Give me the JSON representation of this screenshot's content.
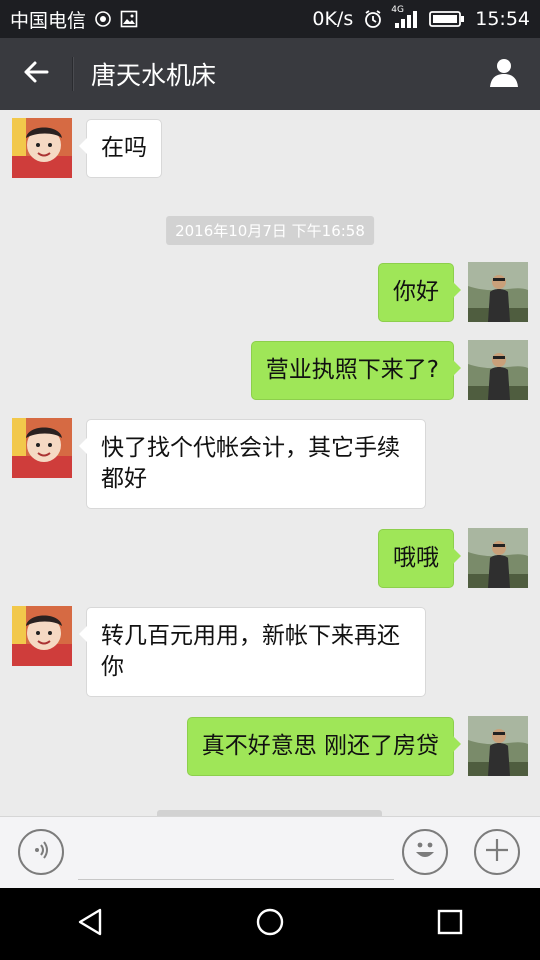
{
  "status_bar": {
    "carrier": "中国电信",
    "net_speed": "0K/s",
    "network_type": "4G",
    "time": "15:54"
  },
  "header": {
    "title": "唐天水机床",
    "back_icon": "arrow-left-icon",
    "profile_icon": "person-icon"
  },
  "messages": [
    {
      "side": "in",
      "text": "在吗"
    },
    {
      "type": "time",
      "text": "2016年10月7日 下午16:58"
    },
    {
      "side": "out",
      "text": "你好"
    },
    {
      "side": "out",
      "text": "营业执照下来了?"
    },
    {
      "side": "in",
      "text": "快了找个代帐会计，其它手续都好"
    },
    {
      "side": "out",
      "text": "哦哦"
    },
    {
      "side": "in",
      "text": "转几百元用用，新帐下来再还你"
    },
    {
      "side": "out",
      "text": "真不好意思 刚还了房贷"
    }
  ],
  "input_bar": {
    "voice_icon": "voice-icon",
    "emoji_icon": "emoji-icon",
    "plus_icon": "plus-icon",
    "placeholder": ""
  },
  "nav": {
    "back": "triangle-back-icon",
    "home": "circle-home-icon",
    "recents": "square-recents-icon"
  },
  "colors": {
    "outgoing_bubble": "#9fe658",
    "incoming_bubble": "#ffffff",
    "chat_bg": "#ebebeb",
    "title_bar": "#393a3f"
  }
}
